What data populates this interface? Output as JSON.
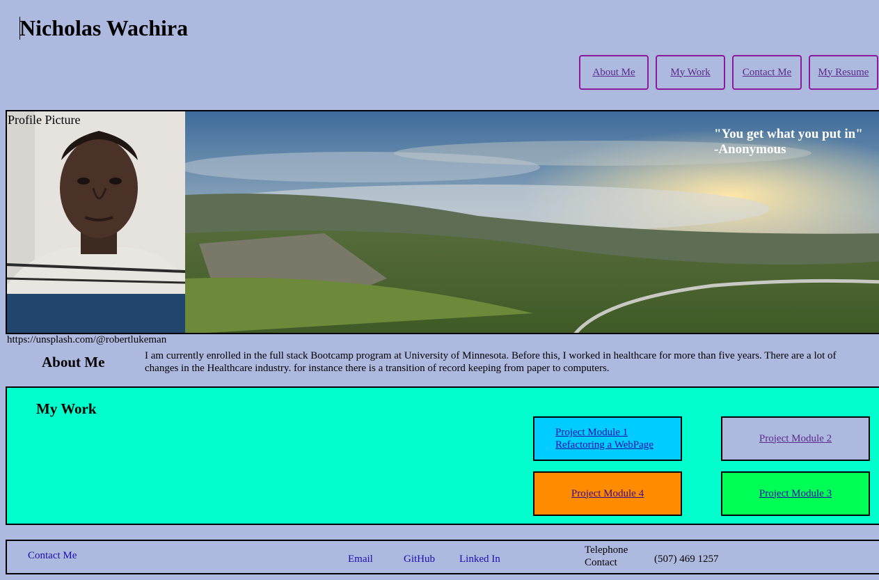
{
  "header": {
    "title": "Nicholas Wachira"
  },
  "nav": {
    "items": [
      {
        "label": "About Me"
      },
      {
        "label": "My Work"
      },
      {
        "label": "Contact Me"
      },
      {
        "label": "My Resume"
      }
    ]
  },
  "hero": {
    "profile_label": "Profile Picture",
    "quote_line1": "\"You get what you put in\"",
    "quote_line2": "-Anonymous",
    "credit": "https://unsplash.com/@robertlukeman"
  },
  "about": {
    "heading": "About Me",
    "line1": "I am currently enrolled in the full stack Bootcamp program at University of Minnesota. Before this, I worked in healthcare for more than five years. There are a lot of",
    "line2": "changes in the Healthcare industry. for instance there is a transition of record keeping from paper to computers."
  },
  "work": {
    "heading": "My Work",
    "projects": [
      {
        "line1": "Project Module 1",
        "line2": "Refactoring a WebPage",
        "color": "#00ccff"
      },
      {
        "label": "Project Module 2",
        "color": "#aeb9df"
      },
      {
        "label": "Project Module 4",
        "color": "#ff8c00"
      },
      {
        "label": "Project Module 3",
        "color": "#00ff55"
      }
    ]
  },
  "footer": {
    "contact": "Contact Me",
    "email": "Email",
    "github": "GitHub",
    "linkedin": "Linked In",
    "telephone_label_1": "Telephone",
    "telephone_label_2": "Contact",
    "phone": "(507) 469 1257"
  }
}
